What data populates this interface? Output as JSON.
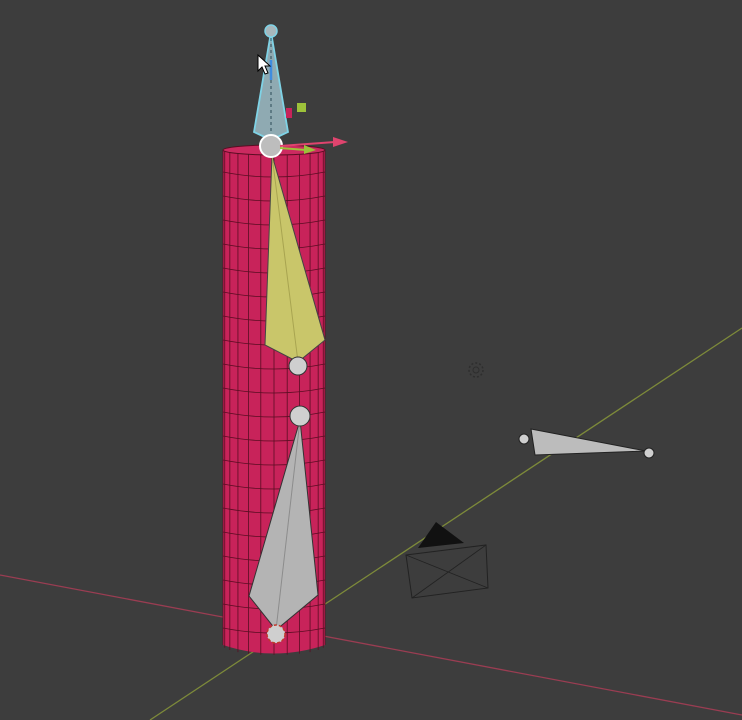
{
  "viewport": {
    "type": "3d-viewport",
    "background_color": "#3d3d3d"
  },
  "colors": {
    "mesh": "#c8235a",
    "mesh_wire": "#5a0d22",
    "active_bone": "#c9c66a",
    "selected_bone_outline": "#7fd3e6",
    "bone": "#b8b8b8",
    "x_axis": "#9a3d52",
    "y_axis": "#7d8a3a",
    "gizmo_x": "#e0446e",
    "gizmo_y": "#9dc23a",
    "gizmo_z": "#3f8de0"
  },
  "objects": [
    {
      "name": "cylinder-mesh",
      "kind": "mesh"
    },
    {
      "name": "armature-chain",
      "kind": "armature",
      "bones": 3,
      "selected_bone": "top",
      "active_bone": "middle"
    },
    {
      "name": "armature-single-bone",
      "kind": "armature"
    },
    {
      "name": "camera",
      "kind": "camera"
    },
    {
      "name": "light",
      "kind": "light"
    }
  ],
  "icons": {
    "cursor": "mouse-pointer-icon",
    "light": "light-icon",
    "camera": "camera-icon",
    "origin": "3d-cursor-icon"
  }
}
